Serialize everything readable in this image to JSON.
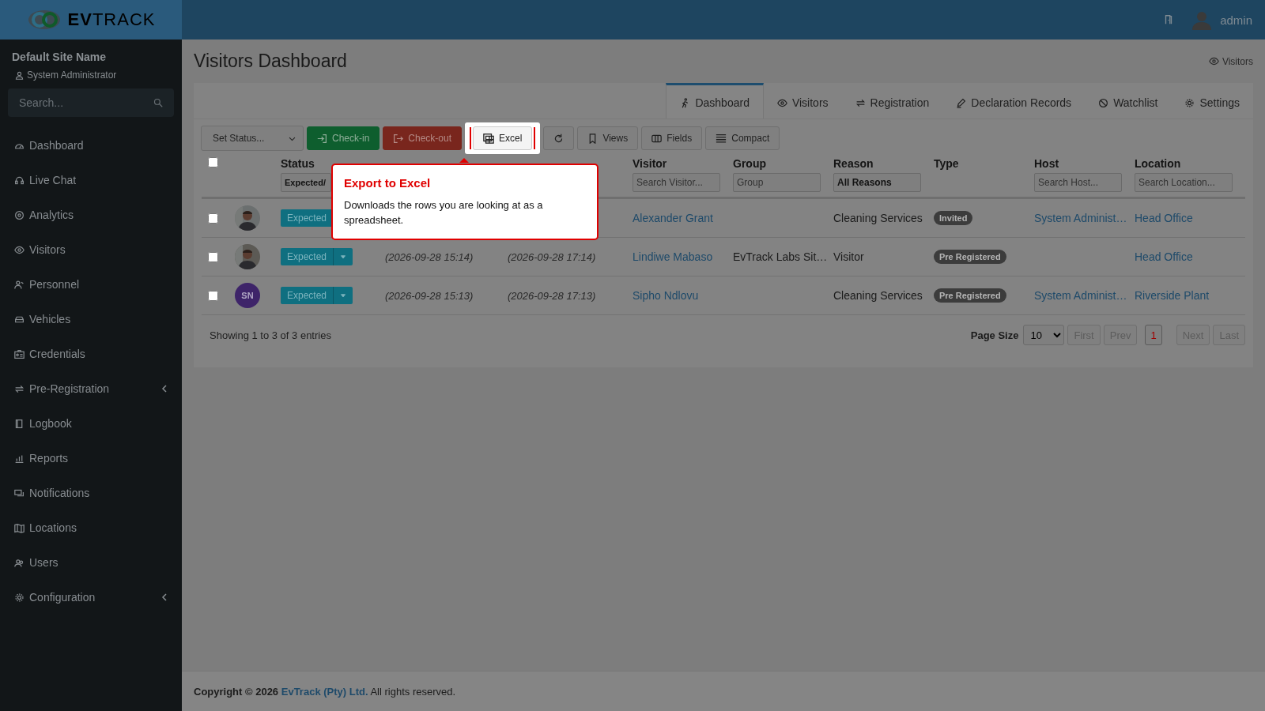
{
  "header": {
    "logo": {
      "bold": "EV",
      "rest": "TRACK"
    },
    "user": "admin"
  },
  "sidebar": {
    "site": "Default Site Name",
    "role": "System Administrator",
    "search_placeholder": "Search...",
    "items": [
      {
        "label": "Dashboard",
        "expandable": false
      },
      {
        "label": "Live Chat",
        "expandable": false
      },
      {
        "label": "Analytics",
        "expandable": false
      },
      {
        "label": "Visitors",
        "expandable": false
      },
      {
        "label": "Personnel",
        "expandable": false
      },
      {
        "label": "Vehicles",
        "expandable": false
      },
      {
        "label": "Credentials",
        "expandable": false
      },
      {
        "label": "Pre-Registration",
        "expandable": true
      },
      {
        "label": "Logbook",
        "expandable": false
      },
      {
        "label": "Reports",
        "expandable": false
      },
      {
        "label": "Notifications",
        "expandable": false
      },
      {
        "label": "Locations",
        "expandable": false
      },
      {
        "label": "Users",
        "expandable": false
      },
      {
        "label": "Configuration",
        "expandable": true
      }
    ]
  },
  "page": {
    "title": "Visitors Dashboard",
    "breadcrumb": "Visitors"
  },
  "tabs": [
    {
      "label": "Dashboard",
      "selected": true
    },
    {
      "label": "Visitors",
      "selected": false
    },
    {
      "label": "Registration",
      "selected": false
    },
    {
      "label": "Declaration Records",
      "selected": false
    },
    {
      "label": "Watchlist",
      "selected": false
    },
    {
      "label": "Settings",
      "selected": false
    }
  ],
  "toolbar": {
    "status_select": "Set Status...",
    "buttons": [
      {
        "kind": "success",
        "label": "Check-in"
      },
      {
        "kind": "danger",
        "label": "Check-out"
      },
      {
        "kind": "highlighted",
        "label": "Excel"
      },
      {
        "kind": "refresh"
      },
      {
        "kind": "views",
        "label": "Views"
      },
      {
        "kind": "fields",
        "label": "Fields"
      },
      {
        "kind": "compact",
        "label": "Compact"
      }
    ]
  },
  "table": {
    "select_all": false,
    "columns": [
      {
        "label": "Status",
        "filter": {
          "value": "Expected/"
        }
      },
      {
        "label": "Visitor",
        "filter": {
          "placeholder": "Search Visitor..."
        }
      },
      {
        "label": "Group",
        "filter": {
          "placeholder": "Group"
        }
      },
      {
        "label": "Reason",
        "filter": {
          "value": "All Reasons"
        }
      },
      {
        "label": "Type"
      },
      {
        "label": "Host",
        "filter": {
          "placeholder": "Search Host..."
        }
      },
      {
        "label": "Location",
        "filter": {
          "placeholder": "Search Location..."
        }
      }
    ],
    "rows": [
      {
        "checked": false,
        "status": "Expected",
        "status_menu": false,
        "visitor": "Alexander Grant",
        "reason": "Cleaning Services",
        "type": "Invited",
        "host": "System Administ…",
        "location": "Head Office"
      },
      {
        "checked": false,
        "status": "Expected",
        "status_menu": true,
        "time_in": "(2026-09-28 15:14)",
        "time_out": "(2026-09-28 17:14)",
        "visitor": "Lindiwe Mabaso",
        "group": "EvTrack Labs Sit…",
        "reason": "Visitor",
        "type": "Pre Registered",
        "location": "Head Office"
      },
      {
        "checked": false,
        "avatar": {
          "kind": "initials",
          "text": "SN",
          "color": "#3e2469"
        },
        "status": "Expected",
        "status_menu": true,
        "time_in": "(2026-09-28 15:13)",
        "time_out": "(2026-09-28 17:13)",
        "visitor": "Sipho Ndlovu",
        "reason": "Cleaning Services",
        "type": "Pre Registered",
        "host": "System Administ…",
        "location": "Riverside Plant"
      }
    ]
  },
  "summary": "Showing 1 to 3 of 3 entries",
  "pagination": {
    "page_size_label": "Page Size",
    "page_size": "10",
    "buttons": [
      {
        "label": "First",
        "kind": "nav",
        "selected": false
      },
      {
        "label": "Prev",
        "kind": "nav",
        "selected": false
      },
      {
        "label": "1",
        "kind": "page",
        "selected": true
      },
      {
        "label": "Next",
        "kind": "nav",
        "selected": false
      },
      {
        "label": "Last",
        "kind": "nav",
        "selected": false
      }
    ]
  },
  "tooltip": {
    "title": "Export to Excel",
    "text": "Downloads the rows you are looking at as a spreadsheet."
  },
  "footer": {
    "prefix": "Copyright © 2026",
    "link": "EvTrack (Pty) Ltd.",
    "suffix": "All rights reserved."
  }
}
